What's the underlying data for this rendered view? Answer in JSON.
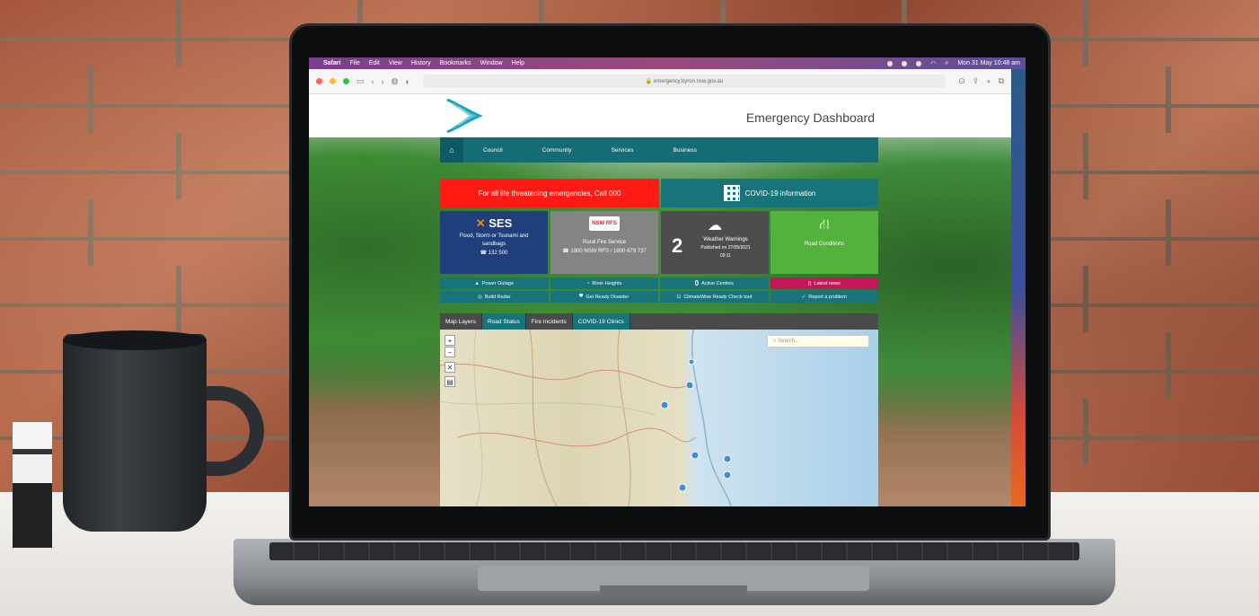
{
  "menubar": {
    "app": "Safari",
    "items": [
      "File",
      "Edit",
      "View",
      "History",
      "Bookmarks",
      "Window",
      "Help"
    ],
    "clock": "Mon 31 May 10:48 am"
  },
  "browser": {
    "url": "emergency.byron.nsw.gov.au"
  },
  "site": {
    "title": "Emergency Dashboard",
    "nav": [
      "Council",
      "Community",
      "Services",
      "Business"
    ],
    "alert": "For all life threatening emergencies, Call 000",
    "covid": "COVID-19 information",
    "tiles": {
      "ses": {
        "logo_mark": "✕",
        "logo_text": "SES",
        "line1": "Flood, Storm or Tsunami and",
        "line2": "sandbags",
        "phone": "☎ 132 500"
      },
      "rfs": {
        "badge": "NSW RFS",
        "title": "Rural Fire Service",
        "phone": "☎ 1800 NSW RFS / 1800 679 737"
      },
      "weather": {
        "count": "2",
        "title": "Weather Warnings",
        "published": "Published on 27/05/2021",
        "time": "09:11"
      },
      "roads": {
        "title": "Road Conditions"
      }
    },
    "row1": [
      "Power Outage",
      "River Heights",
      "0",
      "Active Centres",
      "Latest news"
    ],
    "row2": [
      "Build Radar",
      "Get Ready Disaster",
      "ClimateWise Ready Check tool",
      "Report a problem"
    ],
    "map_tabs": [
      "Map Layers",
      "Road Status",
      "Fire Incidents",
      "COVID-19 Clinics"
    ],
    "map_search_placeholder": "Search..."
  },
  "colors": {
    "teal": "#17747b",
    "alert_red": "#ff1a14",
    "ses_blue": "#1e3f7c",
    "roads_green": "#53b13e",
    "news_pink": "#c2185b"
  }
}
